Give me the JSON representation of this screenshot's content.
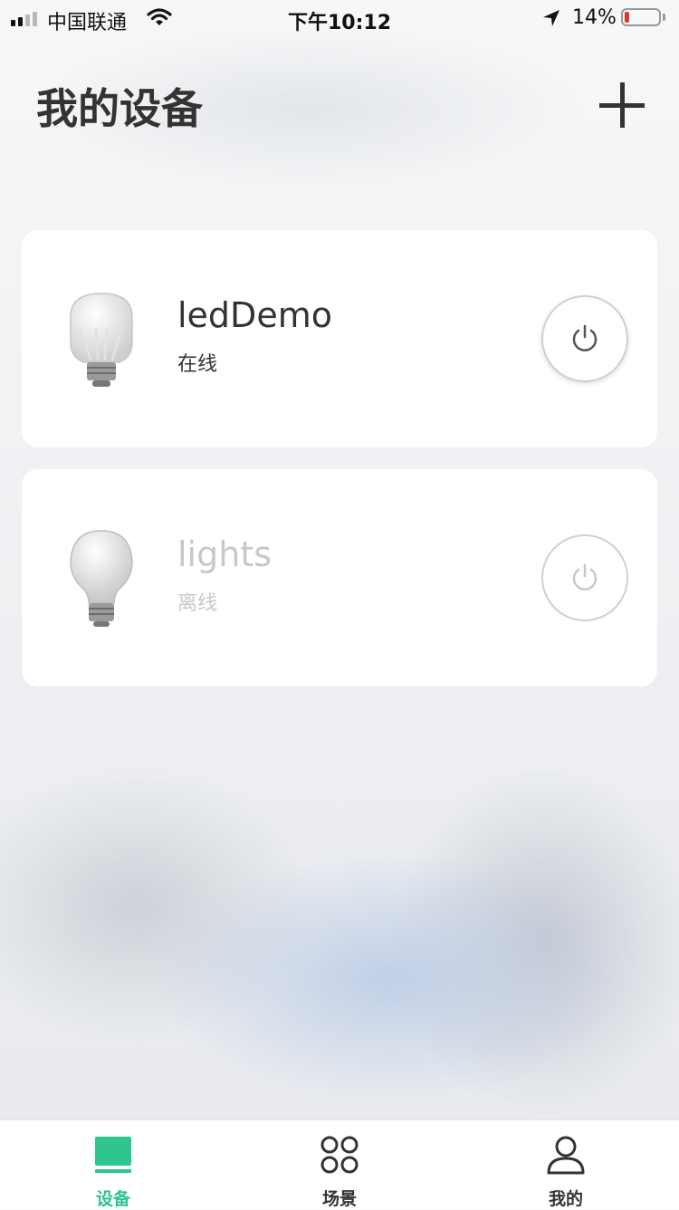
{
  "status_bar": {
    "carrier": "中国联通",
    "time": "下午10:12",
    "battery_percent": "14%",
    "battery_level": 0.14,
    "signal_bars": 2,
    "signal_total": 4
  },
  "header": {
    "title": "我的设备",
    "add_icon": "plus-icon"
  },
  "devices": [
    {
      "name": "ledDemo",
      "status": "在线",
      "online": true,
      "icon": "bulb-icon",
      "power_icon": "power-icon"
    },
    {
      "name": "lights",
      "status": "离线",
      "online": false,
      "icon": "bulb-icon",
      "power_icon": "power-icon"
    }
  ],
  "tab_bar": {
    "tabs": [
      {
        "label": "设备",
        "icon": "device-tab-icon",
        "active": true
      },
      {
        "label": "场景",
        "icon": "scene-grid-icon",
        "active": false
      },
      {
        "label": "我的",
        "icon": "user-icon",
        "active": false
      }
    ]
  },
  "colors": {
    "accent": "#2ec58f",
    "battery_low": "#e8342d",
    "text": "#333333",
    "offline_text": "#c8c8c8"
  }
}
